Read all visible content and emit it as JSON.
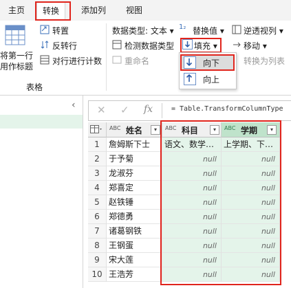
{
  "tabs": [
    "主页",
    "转换",
    "添加列",
    "视图"
  ],
  "ribbon": {
    "left_button_line1": "将第一行",
    "left_button_line2": "用作标题",
    "transpose": "转置",
    "reverse_rows": "反转行",
    "count_rows": "对行进行计数",
    "group_label": "表格",
    "data_type": "数据类型: 文本 ▾",
    "detect_type": "检测数据类型",
    "rename": "重命名",
    "replace_values": "替换值 ▾",
    "fill": "填充 ▾",
    "unpivot": "逆透视列 ▾",
    "move": "移动 ▾",
    "convert_to_list": "转换为列表"
  },
  "fill_menu": {
    "down": "向下",
    "up": "向上"
  },
  "formula_bar": {
    "cancel": "✕",
    "confirm": "✓",
    "fx": "fx",
    "formula": "= Table.TransformColumnType"
  },
  "grid": {
    "columns": [
      {
        "type_icon": "ABC",
        "name": "姓名"
      },
      {
        "type_icon": "ABC",
        "name": "科目"
      },
      {
        "type_icon": "ABC",
        "name": "学期"
      }
    ],
    "rows": [
      [
        "1",
        "詹姆斯下士",
        "语文、数学…",
        "上学期、下…"
      ],
      [
        "2",
        "于予菊",
        "null",
        "null"
      ],
      [
        "3",
        "龙淑芬",
        "null",
        "null"
      ],
      [
        "4",
        "郑喜定",
        "null",
        "null"
      ],
      [
        "5",
        "赵铁锤",
        "null",
        "null"
      ],
      [
        "6",
        "郑德勇",
        "null",
        "null"
      ],
      [
        "7",
        "诸葛钢铁",
        "null",
        "null"
      ],
      [
        "8",
        "王钢蛋",
        "null",
        "null"
      ],
      [
        "9",
        "宋大莲",
        "null",
        "null"
      ],
      [
        "10",
        "王浩芳",
        "null",
        "null"
      ]
    ]
  }
}
